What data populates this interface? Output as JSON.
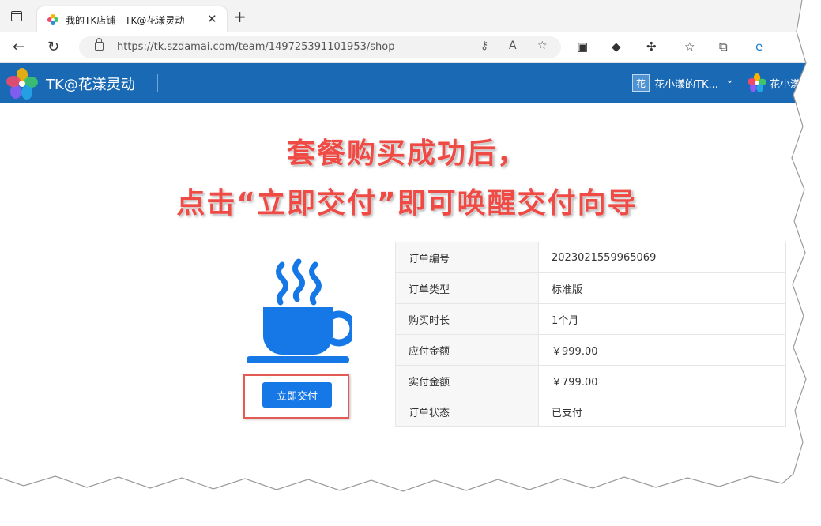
{
  "browser": {
    "tab_title": "我的TK店铺 - TK@花漾灵动",
    "tab_close": "✕",
    "new_tab": "+",
    "url": "https://tk.szdamai.com/team/149725391101953/shop"
  },
  "site": {
    "brand": "TK@花漾灵动",
    "team_badge": "花",
    "team_name": "花小漾的TK...",
    "user_name": "花小漾"
  },
  "banner": {
    "line1": "套餐购买成功后，",
    "line2": "点击“立即交付”即可唤醒交付向导"
  },
  "action": {
    "pay_button": "立即交付"
  },
  "order": {
    "rows": [
      {
        "label": "订单编号",
        "value": "2023021559965069"
      },
      {
        "label": "订单类型",
        "value": "标准版"
      },
      {
        "label": "购买时长",
        "value": "1个月"
      },
      {
        "label": "应付金额",
        "value": "￥999.00"
      },
      {
        "label": "实付金额",
        "value": "￥799.00"
      },
      {
        "label": "订单状态",
        "value": "已支付"
      }
    ]
  },
  "colors": {
    "header_bg": "#1a69b4",
    "accent_blue": "#1677e6",
    "banner_red": "#f04a45",
    "highlight_red": "#e45a55"
  }
}
